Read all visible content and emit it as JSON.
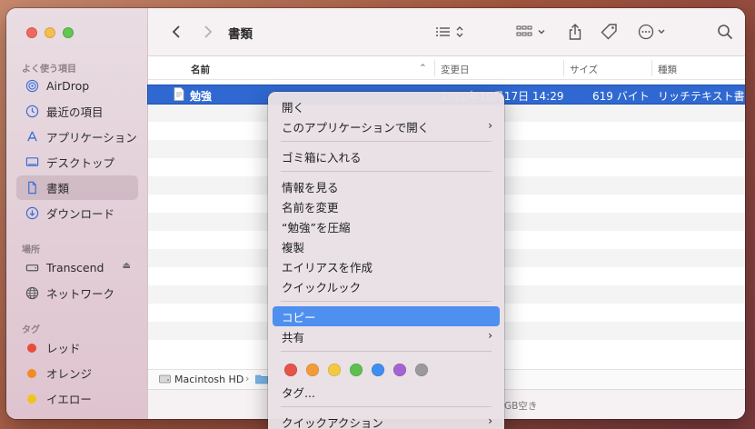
{
  "sidebar": {
    "favorites_title": "よく使う項目",
    "favorites": [
      {
        "label": "AirDrop",
        "icon": "airdrop-icon"
      },
      {
        "label": "最近の項目",
        "icon": "clock-icon"
      },
      {
        "label": "アプリケーション",
        "icon": "applications-icon"
      },
      {
        "label": "デスクトップ",
        "icon": "desktop-icon"
      },
      {
        "label": "書類",
        "icon": "document-icon"
      },
      {
        "label": "ダウンロード",
        "icon": "download-icon"
      }
    ],
    "locations_title": "場所",
    "locations": [
      {
        "label": "Transcend",
        "icon": "drive-icon"
      },
      {
        "label": "ネットワーク",
        "icon": "globe-icon"
      }
    ],
    "tags_title": "タグ",
    "tags": [
      {
        "label": "レッド",
        "color": "#e74c3c"
      },
      {
        "label": "オレンジ",
        "color": "#f08c23"
      },
      {
        "label": "イエロー",
        "color": "#f2c318"
      }
    ]
  },
  "toolbar": {
    "title": "書類"
  },
  "columns": {
    "name": "名前",
    "modified": "変更日",
    "size": "サイズ",
    "kind": "種類"
  },
  "file": {
    "name": "勉強",
    "modified": "2020年10月17日 14:29",
    "size": "619 バイト",
    "kind": "リッチテキスト書類"
  },
  "pathbar": {
    "disk": "Macintosh HD",
    "sep": "›"
  },
  "statusbar": {
    "text": "GB空き"
  },
  "menu": {
    "open": "開く",
    "open_with": "このアプリケーションで開く",
    "trash": "ゴミ箱に入れる",
    "info": "情報を見る",
    "rename": "名前を変更",
    "compress": "“勉強”を圧縮",
    "duplicate": "複製",
    "alias": "エイリアスを作成",
    "quicklook": "クイックルック",
    "copy": "コピー",
    "share": "共有",
    "tags": "タグ...",
    "quick_actions": "クイックアクション",
    "tag_colors": [
      "#e5534b",
      "#f29b38",
      "#f4c942",
      "#5cbf4e",
      "#3d8ef0",
      "#a364d3",
      "#9a9a9c"
    ]
  }
}
